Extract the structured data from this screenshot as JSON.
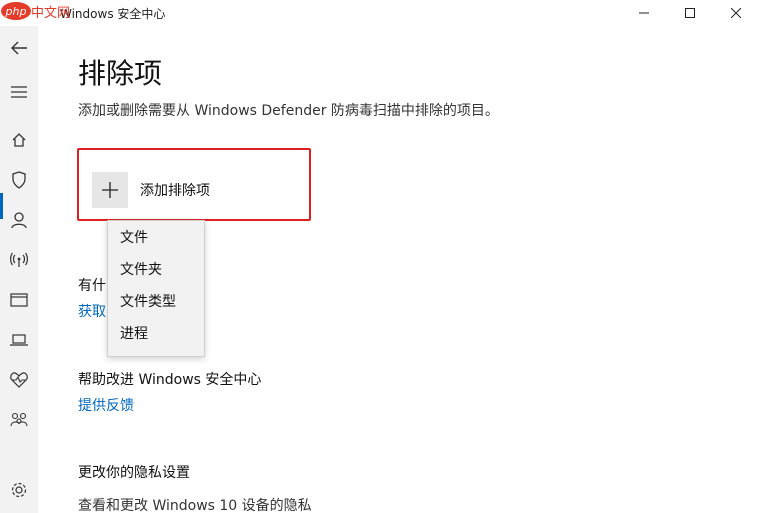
{
  "window": {
    "title": "Windows 安全中心",
    "watermark": "php中文网",
    "minimize_icon": "minimize-icon",
    "maximize_icon": "maximize-icon",
    "close_icon": "close-icon"
  },
  "sidebar": {
    "items": [
      {
        "icon": "back-arrow-icon"
      },
      {
        "icon": "hamburger-menu-icon"
      },
      {
        "icon": "home-icon"
      },
      {
        "icon": "shield-icon",
        "active": true
      },
      {
        "icon": "person-icon"
      },
      {
        "icon": "wireless-icon"
      },
      {
        "icon": "app-browser-icon"
      },
      {
        "icon": "laptop-icon"
      },
      {
        "icon": "heart-pulse-icon"
      },
      {
        "icon": "family-icon"
      },
      {
        "icon": "gear-icon"
      }
    ]
  },
  "main": {
    "title": "排除项",
    "description": "添加或删除需要从 Windows Defender 防病毒扫描中排除的项目。",
    "add_button_label": "添加排除项",
    "questions_heading_partial": "有什",
    "questions_link_partial": "获取",
    "improve_heading": "帮助改进 Windows 安全中心",
    "feedback_link": "提供反馈",
    "privacy_heading": "更改你的隐私设置",
    "privacy_desc": "查看和更改 Windows 10 设备的隐私"
  },
  "dropdown": {
    "items": [
      "文件",
      "文件夹",
      "文件类型",
      "进程"
    ]
  },
  "colors": {
    "accent": "#0067c0",
    "highlight_border": "#e02020",
    "sidebar_bg": "#f2f2f2"
  }
}
